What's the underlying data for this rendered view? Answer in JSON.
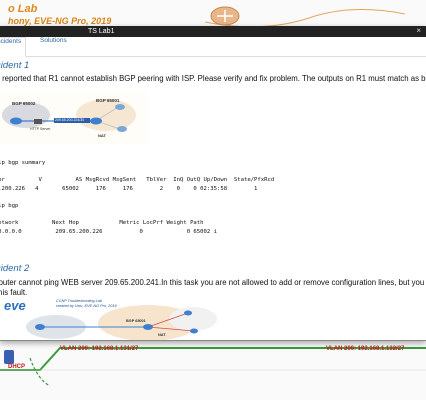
{
  "background": {
    "lab_title": "o Lab",
    "lab_subtitle": "hony, EVE-NG Pro, 2019",
    "vlan_left": "VLAN 200:  192.168.1.131/27",
    "vlan_right": "VLAN 200:  192.168.1.132/27",
    "node_label": "DHCP"
  },
  "window": {
    "title": "TS Lab1",
    "close_label": "×"
  },
  "tabs": [
    {
      "label": "ncidents"
    },
    {
      "label": "Solutions"
    }
  ],
  "incident1": {
    "heading": "cident 1",
    "text": "s reported that R1 cannot establish BGP peering with ISP. Please verify and fix problem. The outputs on R1 must match as bel",
    "diagram": {
      "bgp_left": "BGP 65002",
      "bgp_right": "BGP 65001",
      "link_label": "209.65.200.224/30",
      "http_label": "HTTP Server",
      "nat_label": "NAT"
    },
    "cli1": "sh ip bgp summary\n\nghbor          V          AS MsgRcvd MsgSent   TblVer  InQ OutQ Up/Down  State/PfxRcd\n.65.200.226   4       65002     176     176        2    0    0 02:35:58        1\n\nsh ip bgp\n\n  Network          Next Hop            Metric LocPrf Weight Path\n   0.0.0.0          209.65.200.226           0             0 65002 i"
  },
  "incident2": {
    "heading": "cident 2",
    "text_line1": " router cannot ping WEB server 209.65.200.241.In this task you are not allowed to add or remove configuration lines, but you c",
    "text_line2": " this fault.",
    "diagram": {
      "logo": "eve",
      "caption_line1": "CCNP Troubleshooting Lab",
      "caption_line2": "created by Uxiu, EVE-NG Pro, 2019",
      "bgp_label": "BGP 65001",
      "nat_label": "NAT"
    }
  }
}
